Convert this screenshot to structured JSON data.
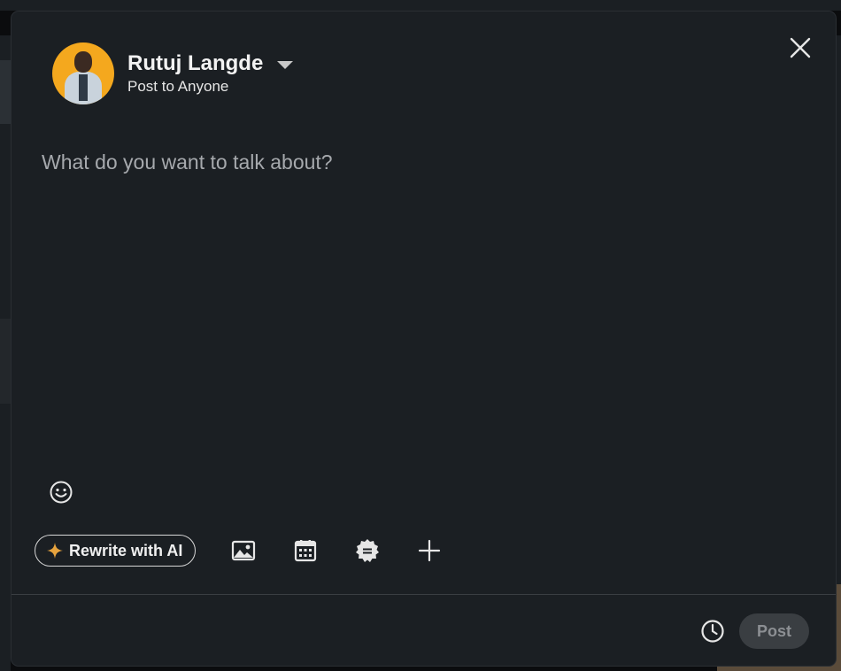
{
  "composer": {
    "author_name": "Rutuj Langde",
    "visibility_label": "Post to Anyone",
    "editor_placeholder": "What do you want to talk about?",
    "rewrite_ai_label": "Rewrite with AI",
    "post_label": "Post"
  },
  "icons": {
    "close": "close-icon",
    "dropdown": "caret-down-icon",
    "emoji": "smiley-icon",
    "sparkle": "sparkle-icon",
    "media": "image-icon",
    "event": "calendar-icon",
    "celebrate": "badge-icon",
    "more": "plus-icon",
    "schedule": "clock-icon"
  },
  "colors": {
    "modal_bg": "#1b1f23",
    "accent_sparkle": "#e7a33e",
    "post_disabled_bg": "#3a3e42",
    "post_disabled_text": "#8c8f93"
  }
}
